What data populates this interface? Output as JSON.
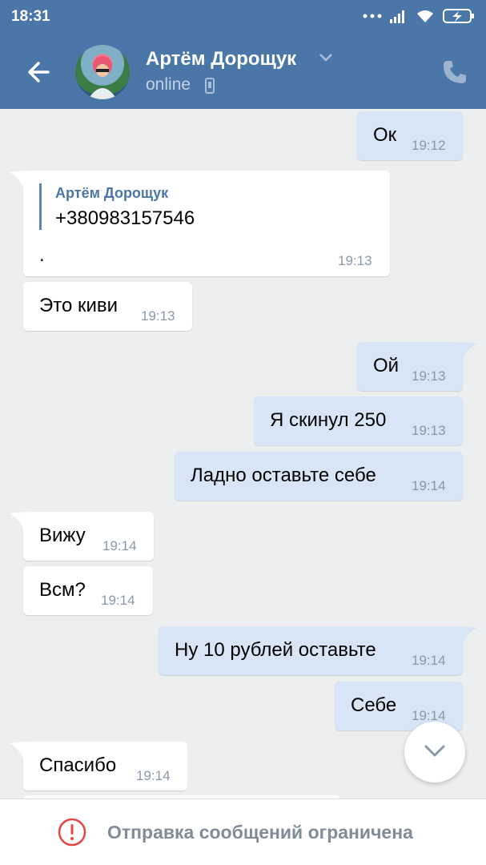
{
  "status_bar": {
    "time": "18:31",
    "icons": [
      "more-icon",
      "signal-icon",
      "wifi-icon",
      "battery-charging-icon"
    ]
  },
  "header": {
    "back_icon": "arrow-left-icon",
    "name": "Артём Дорощук",
    "status": "online",
    "status_icon": "phone-device-icon",
    "call_icon": "phone-icon"
  },
  "messages": [
    {
      "dir": "out",
      "text": "Ок",
      "time": "19:12"
    },
    {
      "dir": "in",
      "forward": {
        "author": "Артём Дорощук",
        "text": "+380983157546"
      },
      "text": ".",
      "time": "19:13"
    },
    {
      "dir": "in",
      "text": "Это киви",
      "time": "19:13"
    },
    {
      "dir": "out",
      "text": "Ой",
      "time": "19:13"
    },
    {
      "dir": "out",
      "text": "Я скинул 250",
      "time": "19:13"
    },
    {
      "dir": "out",
      "text": "Ладно оставьте себе",
      "time": "19:14"
    },
    {
      "dir": "in",
      "text": "Вижу",
      "time": "19:14"
    },
    {
      "dir": "in",
      "text": "Всм?",
      "time": "19:14"
    },
    {
      "dir": "out",
      "text": "Ну 10 рублей оставьте",
      "time": "19:14"
    },
    {
      "dir": "out",
      "text": "Себе",
      "time": "19:14"
    },
    {
      "dir": "in",
      "text": "Спасибо",
      "time": "19:14"
    }
  ],
  "scroll_button_icon": "chevron-down-icon",
  "footer": {
    "warning_icon": "exclamation-circle-icon",
    "text": "Отправка сообщений ограничена"
  },
  "colors": {
    "header": "#4a76a8",
    "incoming": "#ffffff",
    "outgoing": "#d7e5f6",
    "background": "#edeef0",
    "warning": "#e64646"
  }
}
